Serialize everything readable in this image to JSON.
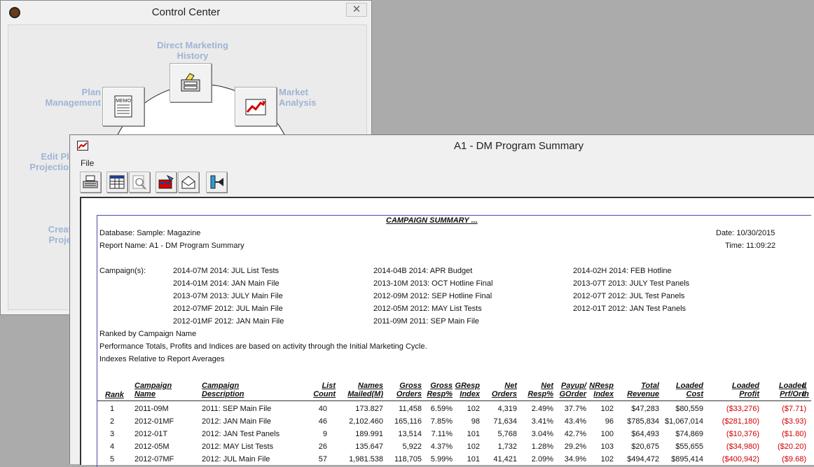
{
  "control_center": {
    "title": "Control Center",
    "close_glyph": "✕",
    "labels": {
      "direct_marketing": "Direct Marketing\nHistory",
      "market_analysis": "Market\nAnalysis",
      "plan_management": "Plan\nManagement",
      "edit_plan": "Edit Pla\nProjection",
      "create": "Creat\nProje"
    },
    "icons": [
      "memo-icon",
      "filing-cabinet-icon",
      "chart-trend-icon"
    ]
  },
  "report_window": {
    "title": "A1 - DM Program Summary",
    "menu": [
      "File"
    ],
    "toolbar": [
      "print-icon",
      "spreadsheet-icon",
      "preview-icon",
      "export-icon",
      "mail-icon",
      "exit-icon"
    ]
  },
  "report": {
    "heading": "CAMPAIGN SUMMARY ...",
    "database": "Database: Sample: Magazine",
    "report_name": "Report Name: A1 - DM Program Summary",
    "date": "Date: 10/30/2015",
    "time": "Time: 11:09:22",
    "campaigns_label": "Campaign(s):",
    "campaigns_col1": [
      "2014-07M  2014: JUL List Tests",
      "2014-01M  2014: JAN Main File",
      "2013-07M  2013: JULY Main File",
      "2012-07MF  2012: JUL Main File",
      "2012-01MF  2012: JAN Main File"
    ],
    "campaigns_col2": [
      "2014-04B  2014: APR Budget",
      "2013-10M  2013: OCT Hotline Final",
      "2012-09M  2012: SEP Hotline Final",
      "2012-05M  2012: MAY List Tests",
      "2011-09M  2011: SEP Main File"
    ],
    "campaigns_col3": [
      "2014-02H  2014: FEB Hotline",
      "2013-07T  2013: JULY Test Panels",
      "2012-07T  2012: JUL Test Panels",
      "2012-01T  2012: JAN Test Panels"
    ],
    "notes": [
      "Ranked by Campaign Name",
      "Performance Totals, Profits and Indices are based on activity through the Initial Marketing Cycle.",
      "Indexes Relative to Report Averages"
    ],
    "columns": [
      "Rank",
      "Campaign\nName",
      "Campaign\nDescription",
      "List\nCount",
      "Names\nMailed(M)",
      "Gross\nOrders",
      "Gross\nResp%",
      "GResp\nIndex",
      "Net\nOrders",
      "Net\nResp%",
      "Payup/\nGOrder",
      "NResp\nIndex",
      "Total\nRevenue",
      "Loaded\nCost",
      "Loaded\nProfit",
      "Loaded\nPrf/Ord",
      "L\nIn"
    ],
    "rows": [
      [
        "1",
        "2011-09M",
        "2011: SEP Main File",
        "40",
        "173.827",
        "11,458",
        "6.59%",
        "102",
        "4,319",
        "2.49%",
        "37.7%",
        "102",
        "$47,283",
        "$80,559",
        "($33,276)",
        "($7.71)"
      ],
      [
        "2",
        "2012-01MF",
        "2012: JAN Main File",
        "46",
        "2,102.460",
        "165,116",
        "7.85%",
        "98",
        "71,634",
        "3.41%",
        "43.4%",
        "96",
        "$785,834",
        "$1,067,014",
        "($281,180)",
        "($3.93)"
      ],
      [
        "3",
        "2012-01T",
        "2012: JAN Test Panels",
        "9",
        "189.991",
        "13,514",
        "7.11%",
        "101",
        "5,768",
        "3.04%",
        "42.7%",
        "100",
        "$64,493",
        "$74,869",
        "($10,376)",
        "($1.80)"
      ],
      [
        "4",
        "2012-05M",
        "2012: MAY List Tests",
        "26",
        "135.647",
        "5,922",
        "4.37%",
        "102",
        "1,732",
        "1.28%",
        "29.2%",
        "103",
        "$20,675",
        "$55,655",
        "($34,980)",
        "($20.20)"
      ],
      [
        "5",
        "2012-07MF",
        "2012: JUL Main File",
        "57",
        "1,981.538",
        "118,705",
        "5.99%",
        "101",
        "41,421",
        "2.09%",
        "34.9%",
        "102",
        "$494,472",
        "$895,414",
        "($400,942)",
        "($9.68)"
      ]
    ]
  }
}
